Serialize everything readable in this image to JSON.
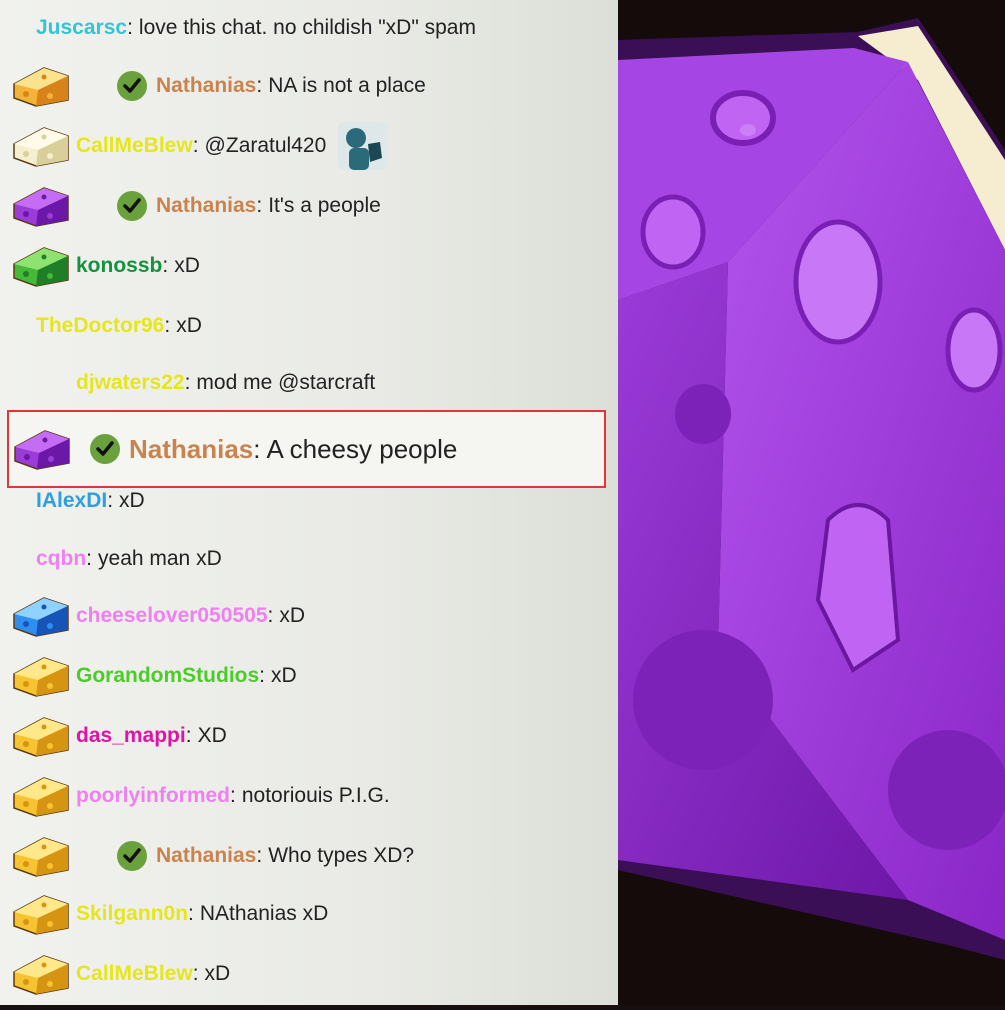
{
  "chat": {
    "messages": [
      {
        "user": "Juscarsc",
        "color": "#35c4d6",
        "text": "love this chat. no childish \"xD\" spam",
        "badge": "none",
        "verified": false
      },
      {
        "user": "Nathanias",
        "color": "#c9834f",
        "text": "NA is not a place",
        "badge": "cheese-orange-icon",
        "verified": true
      },
      {
        "user": "CallMeBlew",
        "color": "#e6e61e",
        "text": "@Zaratul420",
        "badge": "cheese-white-icon",
        "verified": false,
        "emote": "hand-emote-icon"
      },
      {
        "user": "Nathanias",
        "color": "#c9834f",
        "text": "It's a people",
        "badge": "cheese-purple-icon",
        "verified": true
      },
      {
        "user": "konossb",
        "color": "#159140",
        "text": "xD",
        "badge": "cheese-green-icon",
        "verified": false
      },
      {
        "user": "TheDoctor96",
        "color": "#e6e61e",
        "text": "xD",
        "badge": "none",
        "verified": false
      },
      {
        "user": "djwaters22",
        "color": "#e6e61e",
        "text": "mod me @starcraft",
        "badge": "none",
        "verified": false
      },
      {
        "user": "IAlexDI",
        "color": "#2f9fe0",
        "text": "xD",
        "badge": "none",
        "verified": false
      },
      {
        "user": "cqbn",
        "color": "#ee80ef",
        "text": "yeah man xD",
        "badge": "none",
        "verified": false
      },
      {
        "user": "cheeselover050505",
        "color": "#ee80ef",
        "text": "xD",
        "badge": "cheese-blue-icon",
        "verified": false
      },
      {
        "user": "GorandomStudios",
        "color": "#4ccc29",
        "text": "xD",
        "badge": "cheese-yellow-icon",
        "verified": false
      },
      {
        "user": "das_mappi",
        "color": "#dd14a5",
        "text": "XD",
        "badge": "cheese-yellow-icon",
        "verified": false
      },
      {
        "user": "poorlyinformed",
        "color": "#ee80ef",
        "text": "notoriouis P.I.G.",
        "badge": "cheese-yellow-icon",
        "verified": false
      },
      {
        "user": "Nathanias",
        "color": "#c9834f",
        "text": "Who types XD?",
        "badge": "cheese-yellow-icon",
        "verified": true
      },
      {
        "user": "Skilgann0n",
        "color": "#e6e61e",
        "text": "NAthanias xD",
        "badge": "cheese-yellow-icon",
        "verified": false
      },
      {
        "user": "CallMeBlew",
        "color": "#e6e61e",
        "text": "xD",
        "badge": "cheese-yellow-icon",
        "verified": false
      }
    ],
    "highlighted": {
      "user": "Nathanias",
      "color": "#c9834f",
      "text": "A cheesy people",
      "badge": "cheese-purple-icon",
      "verified": true
    }
  },
  "art": {
    "subject": "purple-cheese-wedge-icon",
    "accent": "#9b34d6"
  }
}
